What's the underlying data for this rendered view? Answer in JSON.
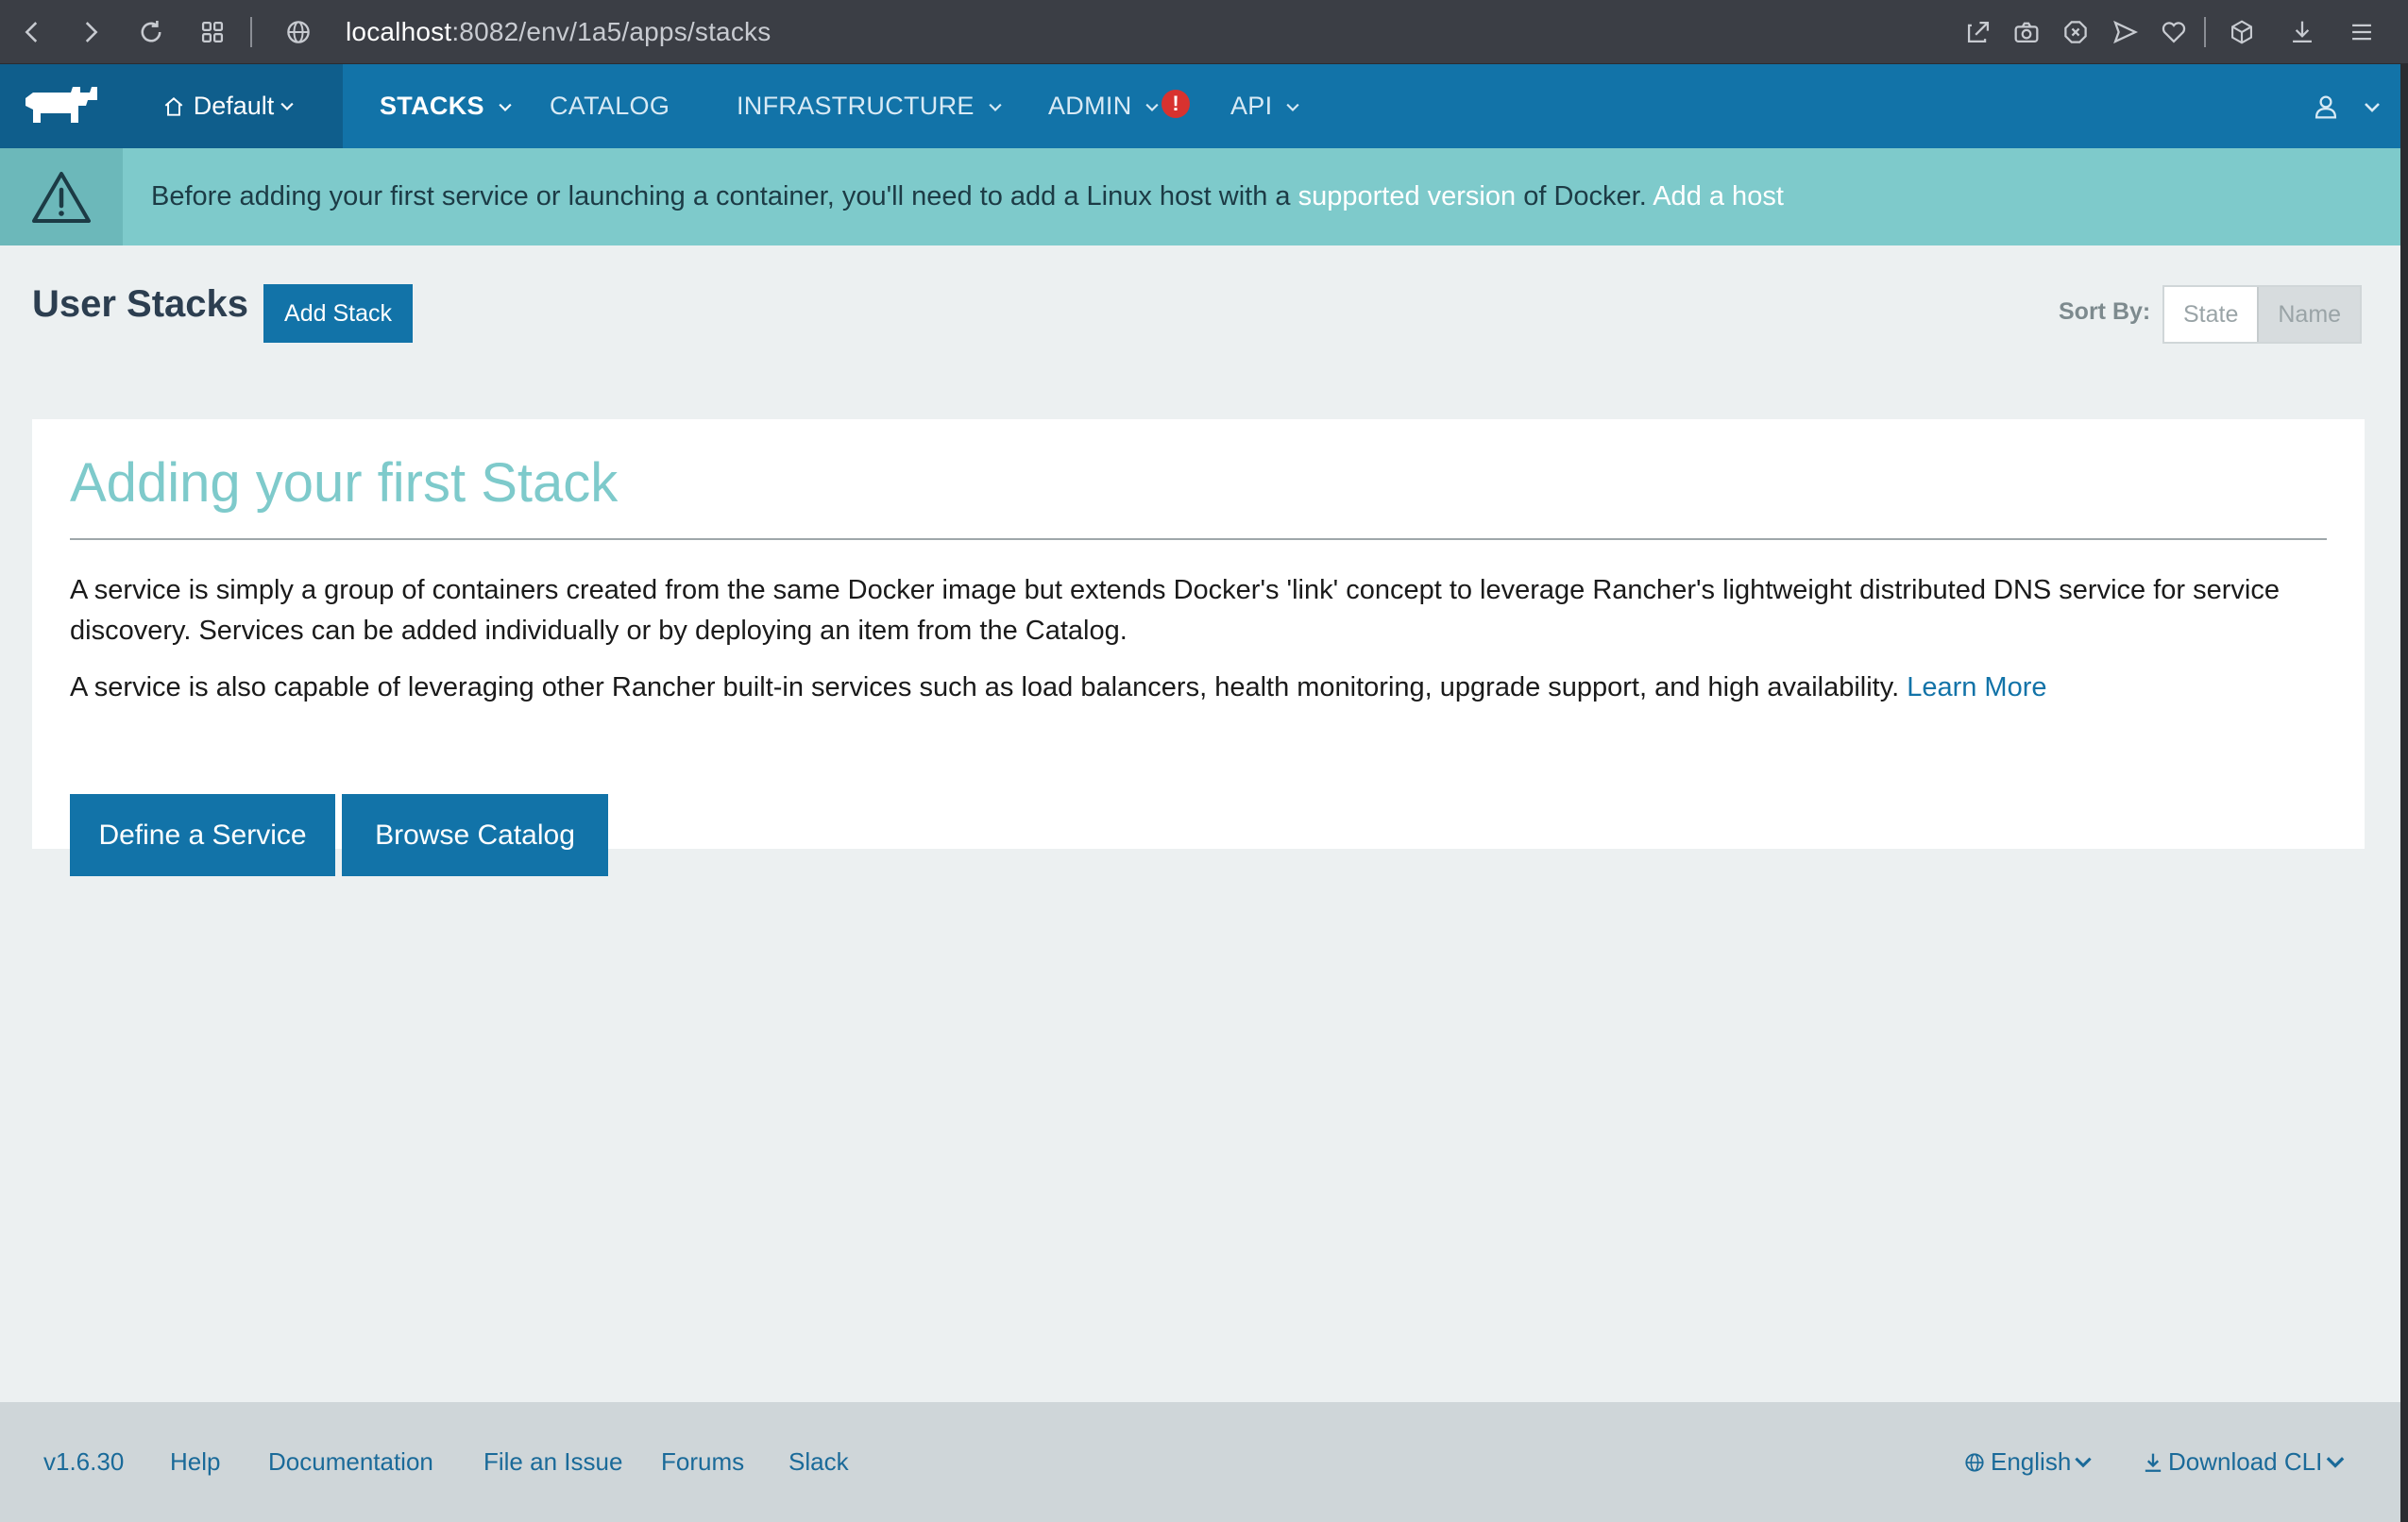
{
  "browser": {
    "url_host": "localhost",
    "url_path": ":8082/env/1a5/apps/stacks"
  },
  "header": {
    "environment": "Default",
    "nav": [
      "STACKS",
      "CATALOG",
      "INFRASTRUCTURE",
      "ADMIN",
      "API"
    ],
    "admin_badge": "!"
  },
  "banner": {
    "text_before": "Before adding your first service or launching a container, you'll need to add a Linux host with a ",
    "link_supported": "supported version",
    "text_middle": " of Docker. ",
    "link_add_host": "Add a host"
  },
  "page": {
    "title": "User Stacks",
    "add_stack": "Add Stack",
    "sort_label": "Sort By:",
    "sort_options": [
      "State",
      "Name"
    ]
  },
  "card": {
    "title": "Adding your first Stack",
    "p1": "A service is simply a group of containers created from the same Docker image but extends Docker's 'link' concept to leverage Rancher's lightweight distributed DNS service for service discovery. Services can be added individually or by deploying an item from the Catalog.",
    "p2": "A service is also capable of leveraging other Rancher built-in services such as load balancers, health monitoring, upgrade support, and high availability. ",
    "learn_more": "Learn More",
    "define_service": "Define a Service",
    "browse_catalog": "Browse Catalog"
  },
  "footer": {
    "version": "v1.6.30",
    "links": [
      "Help",
      "Documentation",
      "File an Issue",
      "Forums",
      "Slack"
    ],
    "language": "English",
    "download_cli": "Download CLI"
  },
  "colors": {
    "brand_blue": "#1273a8",
    "banner_teal": "#7ecacb",
    "badge_red": "#d8322f"
  }
}
